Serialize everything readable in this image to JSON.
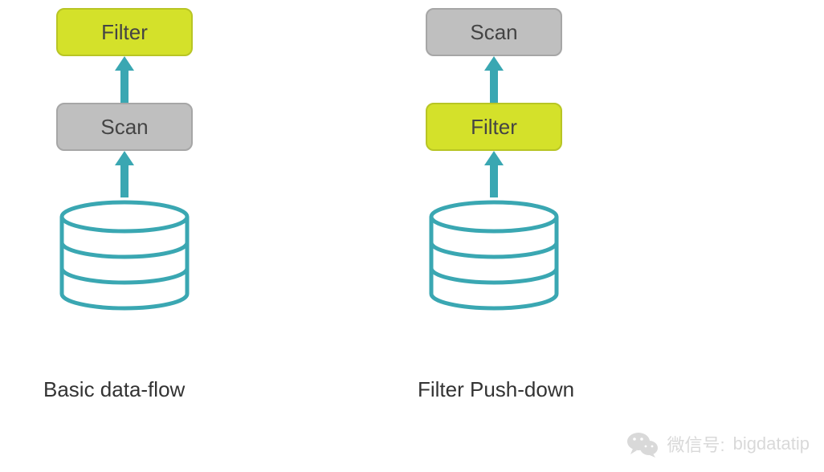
{
  "colors": {
    "filter_fill": "#d4e12a",
    "filter_border": "#b8c524",
    "scan_fill": "#bfbfbf",
    "scan_border": "#a6a6a6",
    "arrow": "#3aa7b2",
    "db_stroke": "#3aa7b2",
    "watermark_text": "#d9d9d9"
  },
  "diagrams": {
    "left": {
      "top_box": {
        "label": "Filter",
        "kind": "filter"
      },
      "bottom_box": {
        "label": "Scan",
        "kind": "scan"
      },
      "caption": "Basic data-flow"
    },
    "right": {
      "top_box": {
        "label": "Scan",
        "kind": "scan"
      },
      "bottom_box": {
        "label": "Filter",
        "kind": "filter"
      },
      "caption": "Filter Push-down"
    }
  },
  "watermark": {
    "icon": "wechat-icon",
    "prefix": "微信号:",
    "account": "bigdatatip"
  }
}
